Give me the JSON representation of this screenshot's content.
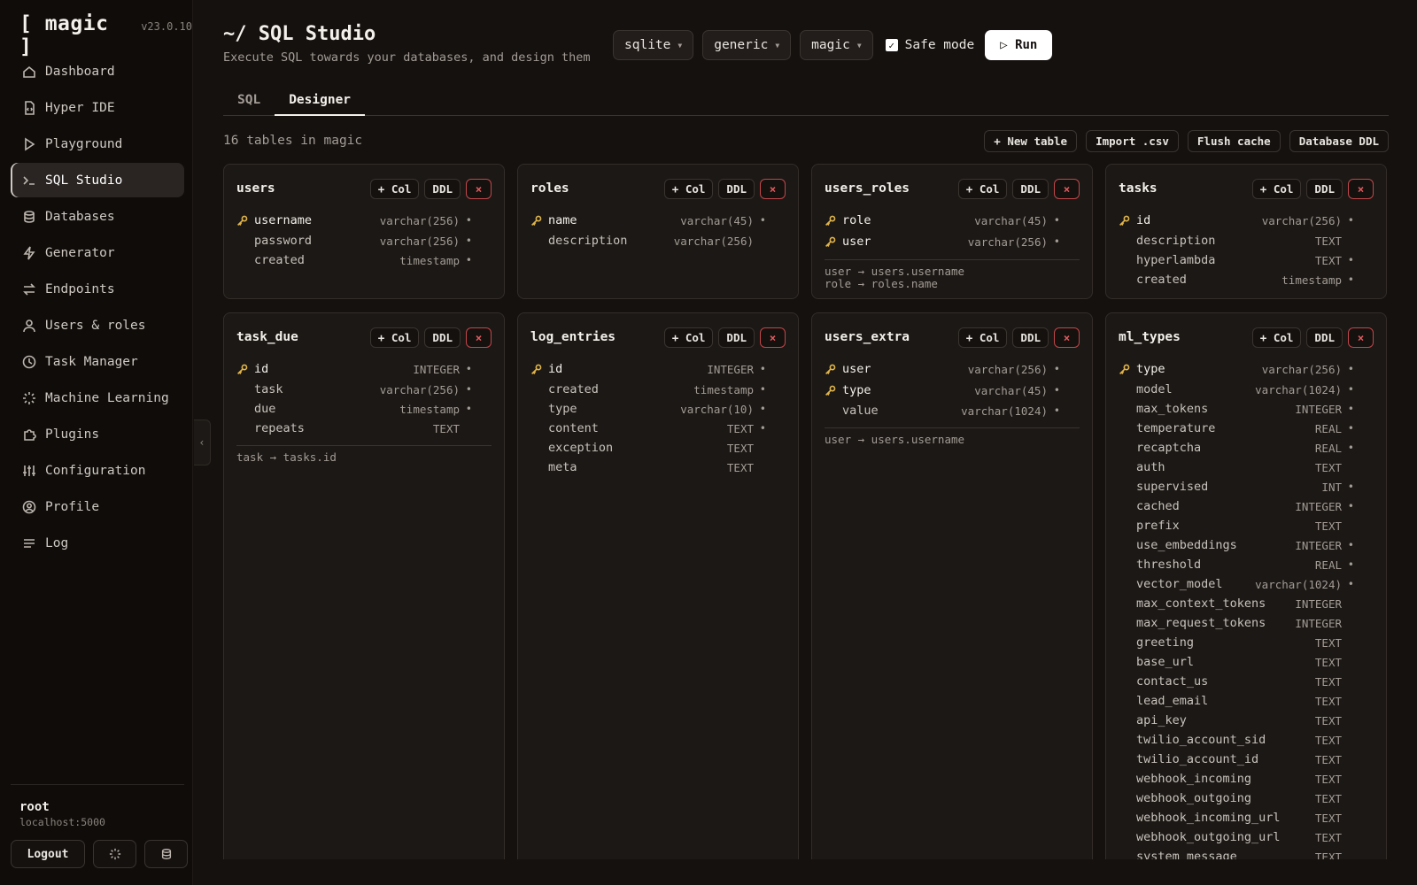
{
  "app": {
    "brand": "[ magic ]",
    "version": "v23.0.10"
  },
  "sidebar": {
    "items": [
      {
        "label": "Dashboard",
        "icon": "home-icon"
      },
      {
        "label": "Hyper IDE",
        "icon": "file-code-icon"
      },
      {
        "label": "Playground",
        "icon": "play-icon"
      },
      {
        "label": "SQL Studio",
        "icon": "terminal-icon",
        "active": true
      },
      {
        "label": "Databases",
        "icon": "database-icon"
      },
      {
        "label": "Generator",
        "icon": "lightning-icon"
      },
      {
        "label": "Endpoints",
        "icon": "swap-arrows-icon"
      },
      {
        "label": "Users & roles",
        "icon": "user-icon"
      },
      {
        "label": "Task Manager",
        "icon": "clock-icon"
      },
      {
        "label": "Machine Learning",
        "icon": "sparkle-icon"
      },
      {
        "label": "Plugins",
        "icon": "puzzle-icon"
      },
      {
        "label": "Configuration",
        "icon": "sliders-icon"
      },
      {
        "label": "Profile",
        "icon": "user-circle-icon"
      },
      {
        "label": "Log",
        "icon": "lines-icon"
      }
    ],
    "user": {
      "name": "root",
      "host": "localhost:5000"
    },
    "logout_label": "Logout"
  },
  "header": {
    "title": "~/ SQL Studio",
    "subtitle": "Execute SQL towards your databases, and design them",
    "db_type": "sqlite",
    "connection": "generic",
    "database": "magic",
    "safe_mode_label": "Safe mode",
    "safe_mode_checked": true,
    "run_label": "▷ Run"
  },
  "tabs": [
    {
      "label": "SQL"
    },
    {
      "label": "Designer",
      "active": true
    }
  ],
  "designer": {
    "table_count": "16 tables in magic",
    "toolbar": [
      "+ New table",
      "Import .csv",
      "Flush cache",
      "Database DDL"
    ],
    "card_buttons": {
      "add_col": "+ Col",
      "ddl": "DDL",
      "delete": "×"
    },
    "tables": [
      {
        "name": "users",
        "columns": [
          {
            "name": "username",
            "type": "varchar(256)",
            "pk": true,
            "not_null": true
          },
          {
            "name": "password",
            "type": "varchar(256)",
            "not_null": true
          },
          {
            "name": "created",
            "type": "timestamp",
            "not_null": true
          }
        ],
        "fks": []
      },
      {
        "name": "roles",
        "columns": [
          {
            "name": "name",
            "type": "varchar(45)",
            "pk": true,
            "not_null": true
          },
          {
            "name": "description",
            "type": "varchar(256)"
          }
        ],
        "fks": []
      },
      {
        "name": "users_roles",
        "columns": [
          {
            "name": "role",
            "type": "varchar(45)",
            "pk": true,
            "not_null": true
          },
          {
            "name": "user",
            "type": "varchar(256)",
            "pk": true,
            "not_null": true
          }
        ],
        "fks": [
          "user → users.username",
          "role → roles.name"
        ]
      },
      {
        "name": "tasks",
        "columns": [
          {
            "name": "id",
            "type": "varchar(256)",
            "pk": true,
            "not_null": true
          },
          {
            "name": "description",
            "type": "TEXT"
          },
          {
            "name": "hyperlambda",
            "type": "TEXT",
            "not_null": true
          },
          {
            "name": "created",
            "type": "timestamp",
            "not_null": true
          }
        ],
        "fks": []
      },
      {
        "name": "task_due",
        "columns": [
          {
            "name": "id",
            "type": "INTEGER",
            "pk": true,
            "not_null": true
          },
          {
            "name": "task",
            "type": "varchar(256)",
            "not_null": true
          },
          {
            "name": "due",
            "type": "timestamp",
            "not_null": true
          },
          {
            "name": "repeats",
            "type": "TEXT"
          }
        ],
        "fks": [
          "task → tasks.id"
        ]
      },
      {
        "name": "log_entries",
        "columns": [
          {
            "name": "id",
            "type": "INTEGER",
            "pk": true,
            "not_null": true
          },
          {
            "name": "created",
            "type": "timestamp",
            "not_null": true
          },
          {
            "name": "type",
            "type": "varchar(10)",
            "not_null": true
          },
          {
            "name": "content",
            "type": "TEXT",
            "not_null": true
          },
          {
            "name": "exception",
            "type": "TEXT"
          },
          {
            "name": "meta",
            "type": "TEXT"
          }
        ],
        "fks": []
      },
      {
        "name": "users_extra",
        "columns": [
          {
            "name": "user",
            "type": "varchar(256)",
            "pk": true,
            "not_null": true
          },
          {
            "name": "type",
            "type": "varchar(45)",
            "pk": true,
            "not_null": true
          },
          {
            "name": "value",
            "type": "varchar(1024)",
            "not_null": true
          }
        ],
        "fks": [
          "user → users.username"
        ]
      },
      {
        "name": "ml_types",
        "columns": [
          {
            "name": "type",
            "type": "varchar(256)",
            "pk": true,
            "not_null": true
          },
          {
            "name": "model",
            "type": "varchar(1024)",
            "not_null": true
          },
          {
            "name": "max_tokens",
            "type": "INTEGER",
            "not_null": true
          },
          {
            "name": "temperature",
            "type": "REAL",
            "not_null": true
          },
          {
            "name": "recaptcha",
            "type": "REAL",
            "not_null": true
          },
          {
            "name": "auth",
            "type": "TEXT"
          },
          {
            "name": "supervised",
            "type": "INT",
            "not_null": true
          },
          {
            "name": "cached",
            "type": "INTEGER",
            "not_null": true
          },
          {
            "name": "prefix",
            "type": "TEXT"
          },
          {
            "name": "use_embeddings",
            "type": "INTEGER",
            "not_null": true
          },
          {
            "name": "threshold",
            "type": "REAL",
            "not_null": true
          },
          {
            "name": "vector_model",
            "type": "varchar(1024)",
            "not_null": true
          },
          {
            "name": "max_context_tokens",
            "type": "INTEGER"
          },
          {
            "name": "max_request_tokens",
            "type": "INTEGER"
          },
          {
            "name": "greeting",
            "type": "TEXT"
          },
          {
            "name": "base_url",
            "type": "TEXT"
          },
          {
            "name": "contact_us",
            "type": "TEXT"
          },
          {
            "name": "lead_email",
            "type": "TEXT"
          },
          {
            "name": "api_key",
            "type": "TEXT"
          },
          {
            "name": "twilio_account_sid",
            "type": "TEXT"
          },
          {
            "name": "twilio_account_id",
            "type": "TEXT"
          },
          {
            "name": "webhook_incoming",
            "type": "TEXT"
          },
          {
            "name": "webhook_outgoing",
            "type": "TEXT"
          },
          {
            "name": "webhook_incoming_url",
            "type": "TEXT"
          },
          {
            "name": "webhook_outgoing_url",
            "type": "TEXT"
          },
          {
            "name": "system_message",
            "type": "TEXT"
          }
        ],
        "fks": []
      }
    ]
  }
}
